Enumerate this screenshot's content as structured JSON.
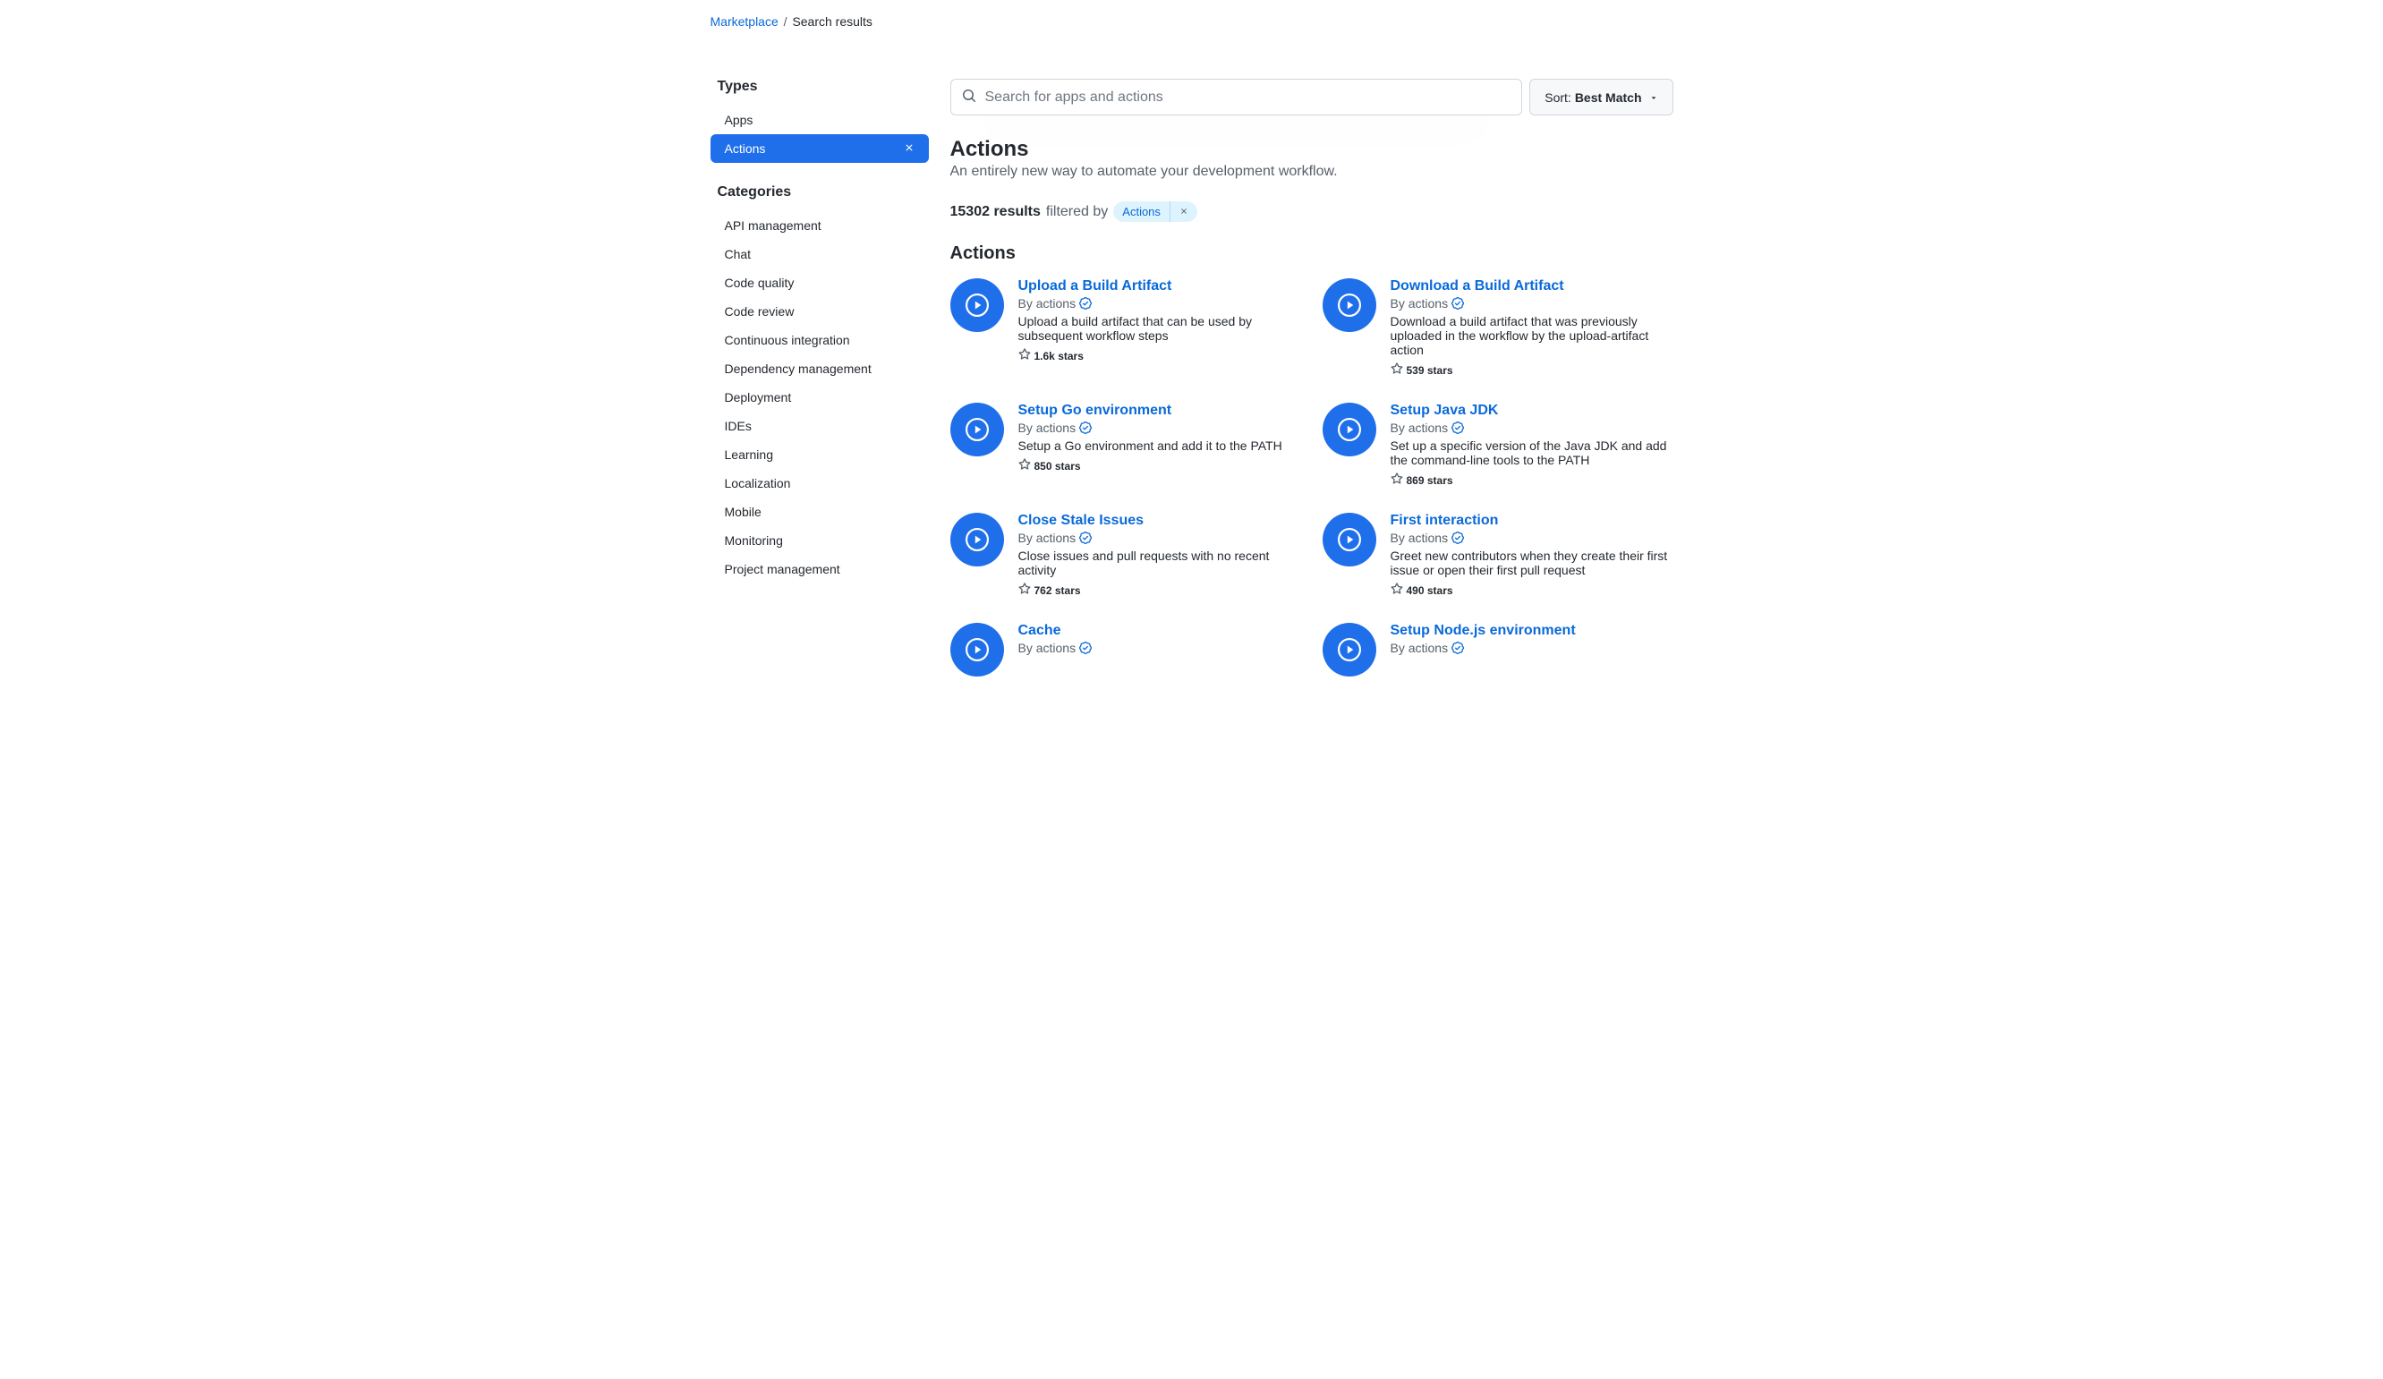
{
  "breadcrumb": {
    "root": "Marketplace",
    "current": "Search results"
  },
  "sidebar": {
    "types_heading": "Types",
    "types": [
      {
        "label": "Apps",
        "active": false
      },
      {
        "label": "Actions",
        "active": true
      }
    ],
    "categories_heading": "Categories",
    "categories": [
      "API management",
      "Chat",
      "Code quality",
      "Code review",
      "Continuous integration",
      "Dependency management",
      "Deployment",
      "IDEs",
      "Learning",
      "Localization",
      "Mobile",
      "Monitoring",
      "Project management"
    ]
  },
  "search": {
    "placeholder": "Search for apps and actions",
    "value": ""
  },
  "sort": {
    "prefix": "Sort:",
    "value": "Best Match"
  },
  "header": {
    "title": "Actions",
    "subtitle": "An entirely new way to automate your development workflow."
  },
  "results": {
    "count": "15302 results",
    "filtered_by": "filtered by",
    "filter_chip": "Actions"
  },
  "list": {
    "heading": "Actions",
    "items": [
      {
        "title": "Upload a Build Artifact",
        "by": "By actions",
        "verified": true,
        "desc": "Upload a build artifact that can be used by subsequent workflow steps",
        "stars": "1.6k stars"
      },
      {
        "title": "Download a Build Artifact",
        "by": "By actions",
        "verified": true,
        "desc": "Download a build artifact that was previously uploaded in the workflow by the upload-artifact action",
        "stars": "539 stars"
      },
      {
        "title": "Setup Go environment",
        "by": "By actions",
        "verified": true,
        "desc": "Setup a Go environment and add it to the PATH",
        "stars": "850 stars"
      },
      {
        "title": "Setup Java JDK",
        "by": "By actions",
        "verified": true,
        "desc": "Set up a specific version of the Java JDK and add the command-line tools to the PATH",
        "stars": "869 stars"
      },
      {
        "title": "Close Stale Issues",
        "by": "By actions",
        "verified": true,
        "desc": "Close issues and pull requests with no recent activity",
        "stars": "762 stars"
      },
      {
        "title": "First interaction",
        "by": "By actions",
        "verified": true,
        "desc": "Greet new contributors when they create their first issue or open their first pull request",
        "stars": "490 stars"
      },
      {
        "title": "Cache",
        "by": "By actions",
        "verified": true,
        "desc": "",
        "stars": ""
      },
      {
        "title": "Setup Node.js environment",
        "by": "By actions",
        "verified": true,
        "desc": "",
        "stars": ""
      }
    ]
  }
}
